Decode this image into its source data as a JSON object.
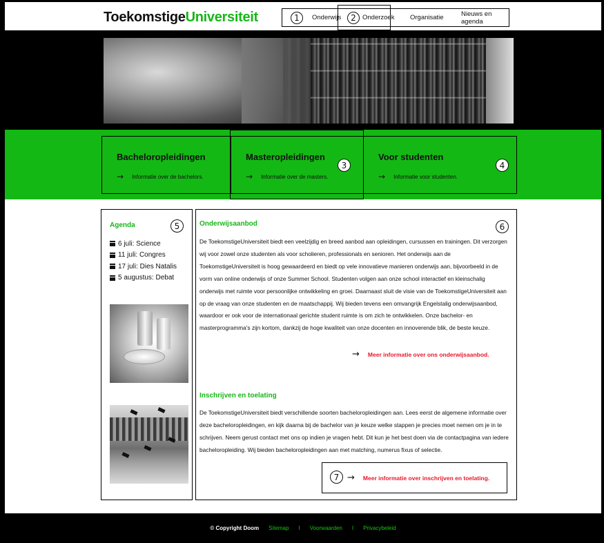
{
  "header": {
    "logo_part1": "Toekomstige",
    "logo_part2": "Universiteit",
    "nav": [
      {
        "label": "Onderwijs",
        "marker": "1"
      },
      {
        "label": "Onderzoek",
        "marker": "2"
      },
      {
        "label": "Organisatie"
      },
      {
        "label": "Nieuws en agenda"
      }
    ]
  },
  "cards": [
    {
      "title": "Bacheloropleidingen",
      "arrow": "→",
      "subtitle": "Informatie over de bachelors."
    },
    {
      "title": "Masteropleidingen",
      "arrow": "→",
      "subtitle": "Informatie over de masters.",
      "marker": "3"
    },
    {
      "title": "Voor studenten",
      "arrow": "→",
      "subtitle": "Informatie voor studenten.",
      "marker": "4"
    }
  ],
  "agenda": {
    "title": "Agenda",
    "marker": "5",
    "items": [
      "6 juli: Science",
      "11 juli: Congres",
      "17 juli: Dies Natalis",
      "5 augustus: Debat"
    ]
  },
  "main": {
    "marker": "6",
    "section1": {
      "title": "Onderwijsaanbod",
      "text": "De ToekomstigeUniversiteit biedt een veelzijdig en breed aanbod aan opleidingen, cursussen en trainingen. Dit verzorgen wij voor zowel onze studenten als voor scholieren, professionals en senioren. Het onderwijs aan de ToekomstigeUniversiteit is hoog gewaardeerd en biedt op vele innovatieve manieren onderwijs aan, bijvoorbeeld in de vorm van online onderwijs of onze Summer School. Studenten volgen aan onze school interactief en kleinschalig onderwijs met ruimte voor persoonlijke ontwikkeling en groei. Daarnaast sluit de visie van de ToekomstigeUniversiteit aan op de vraag van onze studenten en de maatschappij. Wij bieden tevens een omvangrijk Engelstalig onderwijsaanbod, waardoor er ook voor de internationaal gerichte student ruimte is om zich te ontwikkelen. Onze bachelor- en masterprogramma's zijn kortom, dankzij de hoge kwaliteit van onze docenten en innoverende blik, de beste keuze.",
      "link": "Meer informatie over ons onderwijsaanbod.",
      "arrow": "→"
    },
    "section2": {
      "title": "Inschrijven en toelating",
      "text": "De ToekomstigeUniversiteit biedt verschillende soorten bacheloropleidingen aan. Lees eerst de algemene informatie over deze bacheloropleidingen, en kijk daarna bij de bachelor van je keuze welke stappen je precies moet nemen om je in te schrijven. Neem gerust contact met ons op indien je vragen hebt. Dit kun je het best doen via de contactpagina van iedere bacheloropleiding. Wij bieden bacheloropleidingen aan met matching, numerus fixus of selectie.",
      "link": "Meer informatie over inschrijven en toelating.",
      "arrow": "→",
      "marker": "7"
    }
  },
  "footer": {
    "copyright": "© Copyright Doom",
    "links": [
      "Sitemap",
      "Voorwaarden",
      "Privacybeleid"
    ],
    "separator": "I"
  },
  "colors": {
    "accent": "#14b814",
    "link_red": "#e8162a",
    "frame": "#000000"
  }
}
